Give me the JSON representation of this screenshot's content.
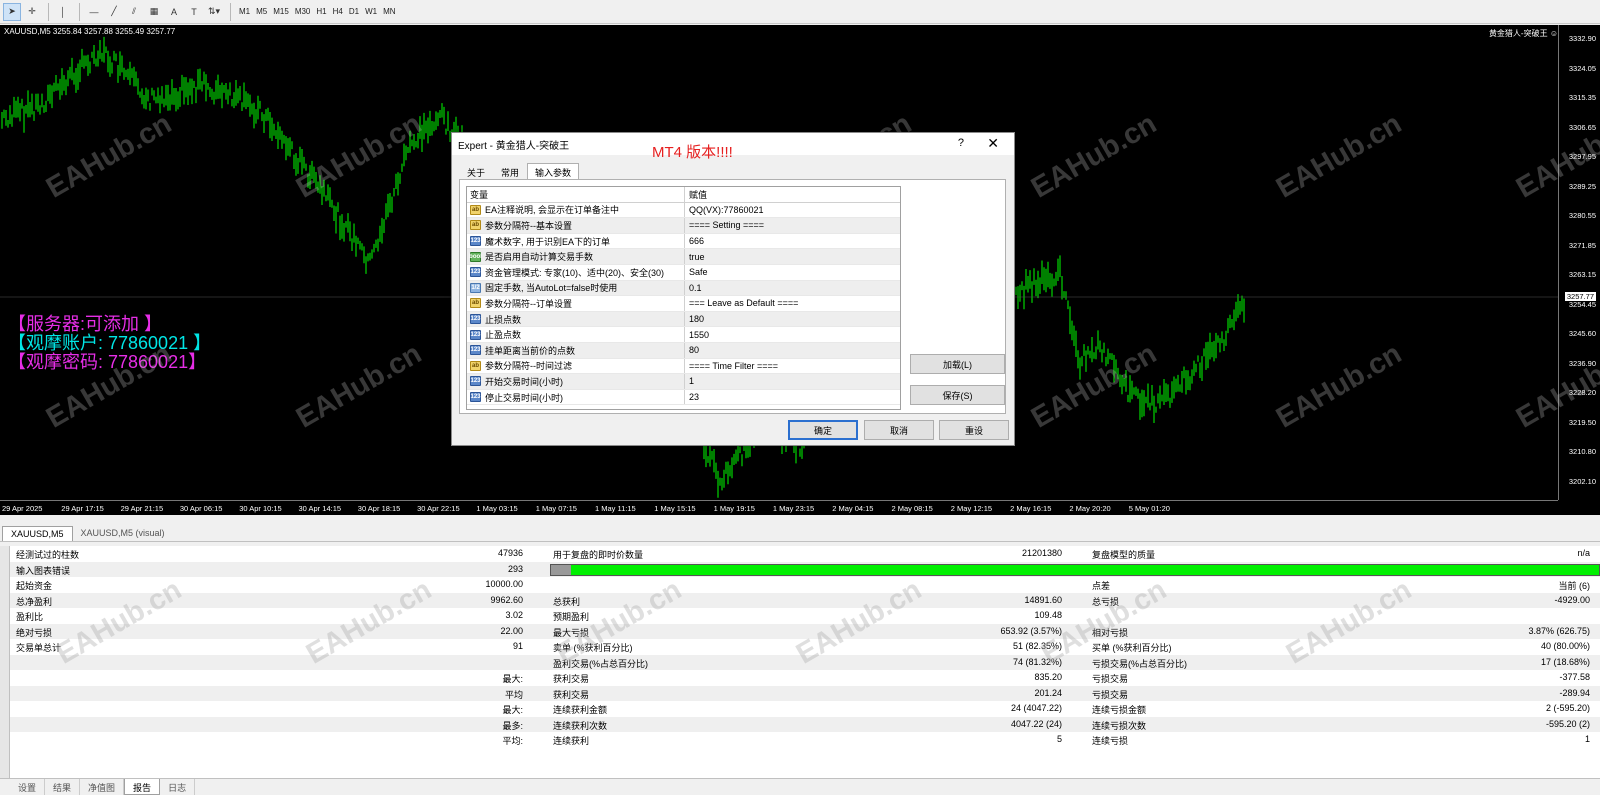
{
  "toolbar": {
    "timeframes": [
      "M1",
      "M5",
      "M15",
      "M30",
      "H1",
      "H4",
      "D1",
      "W1",
      "MN"
    ]
  },
  "chart": {
    "symbol_info": "XAUUSD,M5  3255.84 3257.88 3255.49 3257.77",
    "ea_label": "黄金猎人-突破王 ☺",
    "price_labels": [
      "3332.90",
      "3324.05",
      "3315.35",
      "3306.65",
      "3297.95",
      "3289.25",
      "3280.55",
      "3271.85",
      "3263.15",
      "3254.45",
      "3245.60",
      "3236.90",
      "3228.20",
      "3219.50",
      "3210.80",
      "3202.10"
    ],
    "current_price": "3257.77",
    "time_labels": [
      "29 Apr 2025",
      "29 Apr 17:15",
      "29 Apr 21:15",
      "30 Apr 06:15",
      "30 Apr 10:15",
      "30 Apr 14:15",
      "30 Apr 18:15",
      "30 Apr 22:15",
      "1 May 03:15",
      "1 May 07:15",
      "1 May 11:15",
      "1 May 15:15",
      "1 May 19:15",
      "1 May 23:15",
      "2 May 04:15",
      "2 May 08:15",
      "2 May 12:15",
      "2 May 16:15",
      "2 May 20:20",
      "5 May 01:20"
    ],
    "watermark": "EAHub.cn",
    "promo": {
      "line1": "【服务器:可添加 】",
      "line2": "【观摩账户: 77860021 】",
      "line3": "【观摩密码: 77860021】"
    }
  },
  "dialog": {
    "title": "Expert - 黄金猎人-突破王",
    "help": "?",
    "close": "✕",
    "banner": "MT4 版本!!!!",
    "tabs": [
      "关于",
      "常用",
      "输入参数"
    ],
    "table_header": {
      "variable": "变量",
      "value": "赋值"
    },
    "params": [
      {
        "icon": "ab",
        "name": "EA注释说明, 会显示在订单备注中",
        "value": "QQ(VX):77860021"
      },
      {
        "icon": "ab",
        "name": "参数分隔符--基本设置",
        "value": "==== Setting ===="
      },
      {
        "icon": "123",
        "name": "魔术数字, 用于识别EA下的订单",
        "value": "666"
      },
      {
        "icon": "bool",
        "name": "是否启用自动计算交易手数",
        "value": "true"
      },
      {
        "icon": "123",
        "name": "资金管理模式: 专家(10)、适中(20)、安全(30)",
        "value": "Safe"
      },
      {
        "icon": "1/2",
        "name": "固定手数, 当AutoLot=false时使用",
        "value": "0.1"
      },
      {
        "icon": "ab",
        "name": "参数分隔符--订单设置",
        "value": "=== Leave as Default ===="
      },
      {
        "icon": "123",
        "name": "止损点数",
        "value": "180"
      },
      {
        "icon": "123",
        "name": "止盈点数",
        "value": "1550"
      },
      {
        "icon": "123",
        "name": "挂单距离当前价的点数",
        "value": "80"
      },
      {
        "icon": "ab",
        "name": "参数分隔符--时间过滤",
        "value": "==== Time Filter ===="
      },
      {
        "icon": "123",
        "name": "开始交易时间(小时)",
        "value": "1"
      },
      {
        "icon": "123",
        "name": "停止交易时间(小时)",
        "value": "23"
      }
    ],
    "load_button": "加载(L)",
    "save_button": "保存(S)",
    "ok_button": "确定",
    "cancel_button": "取消",
    "reset_button": "重设"
  },
  "chart_tabs": [
    "XAUUSD,M5",
    "XAUUSD,M5 (visual)"
  ],
  "report": {
    "bars_tested_label": "经测试过的柱数",
    "bars_tested": "47936",
    "ticks_label": "用于复盘的即时价数量",
    "ticks": "21201380",
    "quality_label": "复盘模型的质量",
    "quality": "n/a",
    "mismatch_label": "输入图表错误",
    "mismatch": "293",
    "initial_deposit_label": "起始资金",
    "initial_deposit": "10000.00",
    "spread_label": "点差",
    "spread": "当前 (6)",
    "net_profit_label": "总净盈利",
    "net_profit": "9962.60",
    "gross_profit_label": "总获利",
    "gross_profit": "14891.60",
    "gross_loss_label": "总亏损",
    "gross_loss": "-4929.00",
    "profit_factor_label": "盈利比",
    "profit_factor": "3.02",
    "expected_payoff_label": "预期盈利",
    "expected_payoff": "109.48",
    "abs_drawdown_label": "绝对亏损",
    "abs_drawdown": "22.00",
    "max_drawdown_label": "最大亏损",
    "max_drawdown": "653.92 (3.57%)",
    "rel_drawdown_label": "相对亏损",
    "rel_drawdown": "3.87% (626.75)",
    "total_trades_label": "交易单总计",
    "total_trades": "91",
    "short_label": "卖单 (%获利百分比)",
    "short": "51 (82.35%)",
    "long_label": "买单 (%获利百分比)",
    "long": "40 (80.00%)",
    "profit_trades_label": "盈利交易(%占总百分比)",
    "profit_trades": "74 (81.32%)",
    "loss_trades_label": "亏损交易(%占总百分比)",
    "loss_trades": "17 (18.68%)",
    "largest_label": "最大:",
    "largest_profit_label": "获利交易",
    "largest_profit": "835.20",
    "largest_loss_label": "亏损交易",
    "largest_loss": "-377.58",
    "average_label": "平均",
    "avg_profit_label": "获利交易",
    "avg_profit": "201.24",
    "avg_loss_label": "亏损交易",
    "avg_loss": "-289.94",
    "max_label": "最大:",
    "max_cons_wins_label": "连续获利金额",
    "max_cons_wins": "24 (4047.22)",
    "max_cons_losses_label": "连续亏损金额",
    "max_cons_losses": "2 (-595.20)",
    "maximal_label": "最多:",
    "maximal_cons_profit_label": "连续获利次数",
    "maximal_cons_profit": "4047.22 (24)",
    "maximal_cons_loss_label": "连续亏损次数",
    "maximal_cons_loss": "-595.20 (2)",
    "avg2_label": "平均:",
    "avg_cons_wins_label": "连续获利",
    "avg_cons_wins": "5",
    "avg_cons_losses_label": "连续亏损",
    "avg_cons_losses": "1"
  },
  "tester_tabs": [
    "设置",
    "结果",
    "净值图",
    "报告",
    "日志"
  ],
  "colors": {
    "candle": "#00ff00",
    "promo_magenta": "#e62ee6",
    "promo_cyan": "#00e5e5",
    "quality_bar": "#00f000"
  }
}
